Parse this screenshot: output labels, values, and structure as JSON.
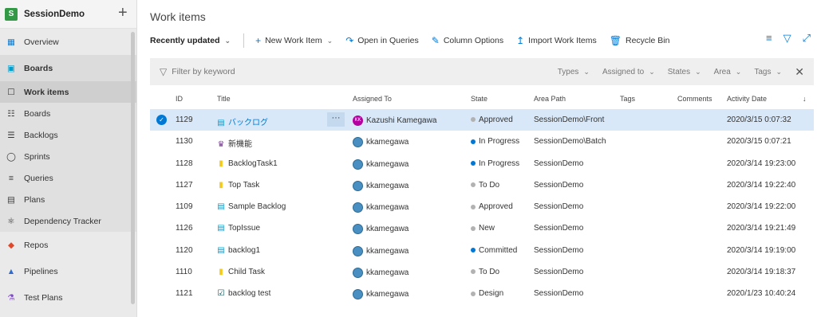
{
  "project": {
    "initial": "S",
    "name": "SessionDemo",
    "add_icon": "plus-icon"
  },
  "nav": [
    {
      "label": "Overview",
      "icon": "overview-icon",
      "color": "#0078d4"
    },
    {
      "label": "Boards",
      "icon": "boards-hub-icon",
      "color": "#009ccc"
    },
    {
      "label": "Work items",
      "icon": "work-items-icon",
      "color": "#333333"
    },
    {
      "label": "Boards",
      "icon": "board-icon",
      "color": "#333333"
    },
    {
      "label": "Backlogs",
      "icon": "backlogs-icon",
      "color": "#333333"
    },
    {
      "label": "Sprints",
      "icon": "sprints-icon",
      "color": "#333333"
    },
    {
      "label": "Queries",
      "icon": "queries-icon",
      "color": "#333333"
    },
    {
      "label": "Plans",
      "icon": "plans-icon",
      "color": "#333333"
    },
    {
      "label": "Dependency Tracker",
      "icon": "dependency-icon",
      "color": "#333333"
    },
    {
      "label": "Repos",
      "icon": "repos-icon",
      "color": "#e0482c"
    },
    {
      "label": "Pipelines",
      "icon": "pipelines-icon",
      "color": "#2f6ccf"
    },
    {
      "label": "Test Plans",
      "icon": "test-plans-icon",
      "color": "#7c4dbf"
    }
  ],
  "page": {
    "title": "Work items"
  },
  "toolbar": {
    "recent": "Recently updated",
    "new_item": "New Work Item",
    "open_queries": "Open in Queries",
    "column_options": "Column Options",
    "import": "Import Work Items",
    "recycle": "Recycle Bin"
  },
  "filter": {
    "placeholder": "Filter by keyword",
    "types": "Types",
    "assigned": "Assigned to",
    "states": "States",
    "area": "Area",
    "tags": "Tags"
  },
  "columns": {
    "id": "ID",
    "title": "Title",
    "assigned": "Assigned To",
    "state": "State",
    "area": "Area Path",
    "tags": "Tags",
    "comments": "Comments",
    "activity": "Activity Date"
  },
  "rows": [
    {
      "id": "1129",
      "title": "バックログ",
      "type": "backlog",
      "assigned": "Kazushi Kamegawa",
      "avatar": "KK",
      "state": "Approved",
      "state_color": "#b2b2b2",
      "area": "SessionDemo\\Front",
      "date": "2020/3/15 0:07:32"
    },
    {
      "id": "1130",
      "title": "新機能",
      "type": "feature",
      "assigned": "kkamegawa",
      "avatar": "",
      "state": "In Progress",
      "state_color": "#0078d4",
      "area": "SessionDemo\\Batch",
      "date": "2020/3/15 0:07:21"
    },
    {
      "id": "1128",
      "title": "BacklogTask1",
      "type": "task",
      "assigned": "kkamegawa",
      "avatar": "",
      "state": "In Progress",
      "state_color": "#0078d4",
      "area": "SessionDemo",
      "date": "2020/3/14 19:23:00"
    },
    {
      "id": "1127",
      "title": "Top Task",
      "type": "task",
      "assigned": "kkamegawa",
      "avatar": "",
      "state": "To Do",
      "state_color": "#b2b2b2",
      "area": "SessionDemo",
      "date": "2020/3/14 19:22:40"
    },
    {
      "id": "1109",
      "title": "Sample Backlog",
      "type": "backlog",
      "assigned": "kkamegawa",
      "avatar": "",
      "state": "Approved",
      "state_color": "#b2b2b2",
      "area": "SessionDemo",
      "date": "2020/3/14 19:22:00"
    },
    {
      "id": "1126",
      "title": "TopIssue",
      "type": "backlog",
      "assigned": "kkamegawa",
      "avatar": "",
      "state": "New",
      "state_color": "#b2b2b2",
      "area": "SessionDemo",
      "date": "2020/3/14 19:21:49"
    },
    {
      "id": "1120",
      "title": "backlog1",
      "type": "backlog",
      "assigned": "kkamegawa",
      "avatar": "",
      "state": "Committed",
      "state_color": "#0078d4",
      "area": "SessionDemo",
      "date": "2020/3/14 19:19:00"
    },
    {
      "id": "1110",
      "title": "Child Task",
      "type": "task",
      "assigned": "kkamegawa",
      "avatar": "",
      "state": "To Do",
      "state_color": "#b2b2b2",
      "area": "SessionDemo",
      "date": "2020/3/14 19:18:37"
    },
    {
      "id": "1121",
      "title": "backlog test",
      "type": "testcase",
      "assigned": "kkamegawa",
      "avatar": "",
      "state": "Design",
      "state_color": "#b2b2b2",
      "area": "SessionDemo",
      "date": "2020/1/23 10:40:24"
    }
  ]
}
